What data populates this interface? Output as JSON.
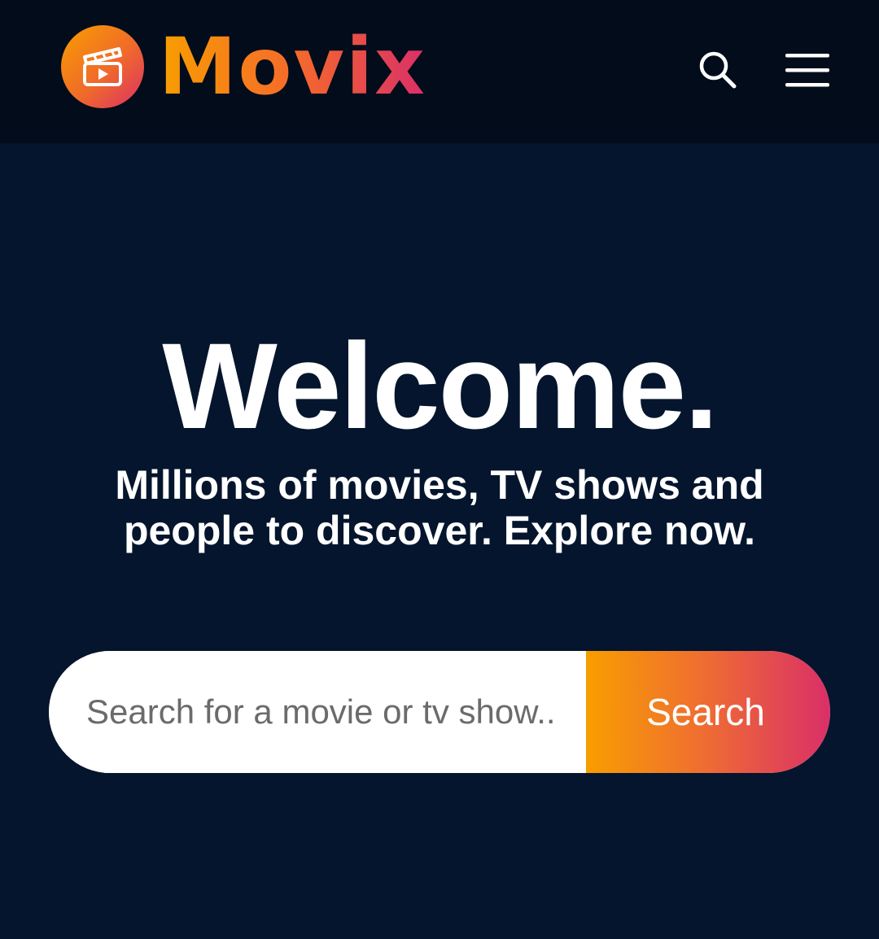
{
  "header": {
    "brand_name": "Movix",
    "search_icon": "search-icon",
    "menu_icon": "hamburger-menu-icon",
    "logo_icon": "film-clapperboard-icon"
  },
  "hero": {
    "title": "Welcome.",
    "subtitle": "Millions of movies, TV shows and people to discover. Explore now."
  },
  "search": {
    "placeholder": "Search for a movie or tv show..",
    "button_label": "Search"
  },
  "colors": {
    "page_background": "#04152d",
    "header_background": "#020c1b",
    "gradient_start": "#f89e00",
    "gradient_end": "#da2f68",
    "text": "#ffffff"
  }
}
